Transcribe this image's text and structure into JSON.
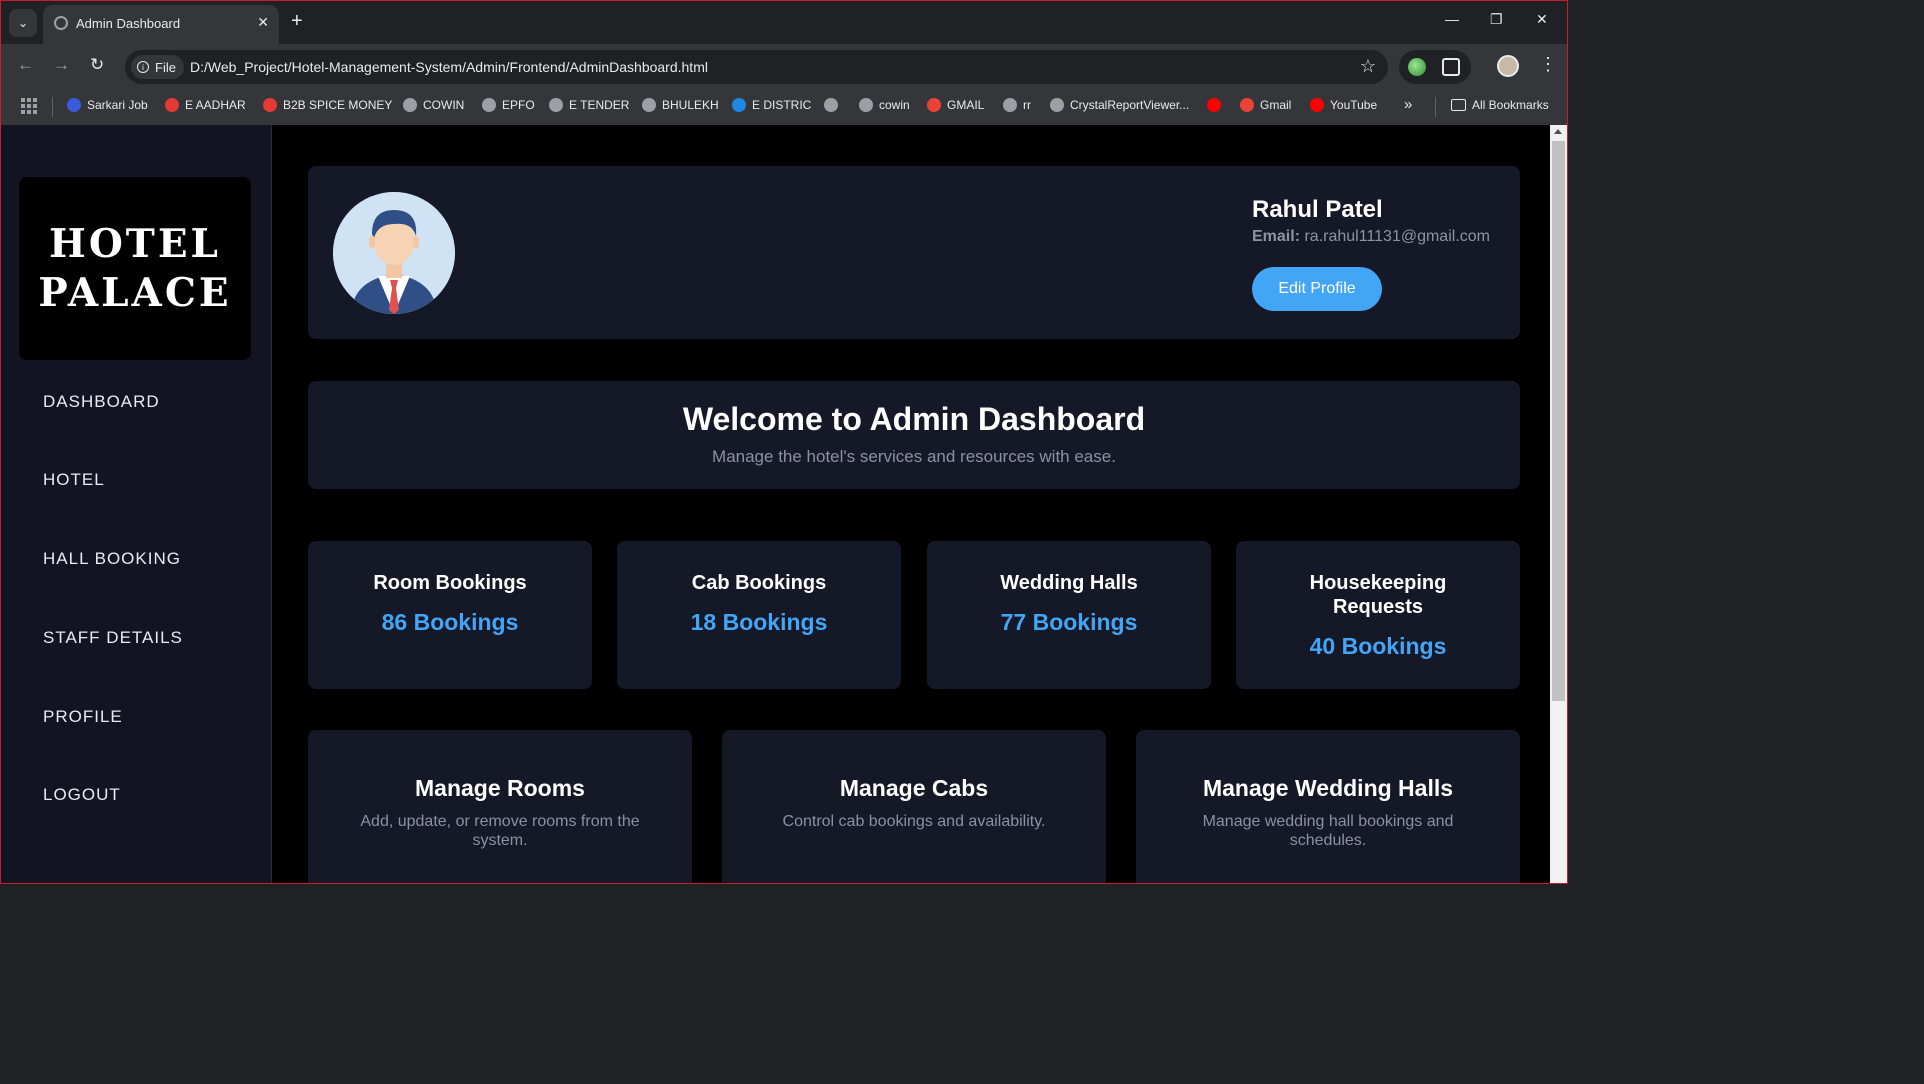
{
  "browser": {
    "tab_title": "Admin Dashboard",
    "file_label": "File",
    "url": "D:/Web_Project/Hotel-Management-System/Admin/Frontend/AdminDashboard.html",
    "bookmarks": [
      {
        "label": "Sarkari Job",
        "color": "#3b5bdb"
      },
      {
        "label": "E AADHAR",
        "color": "#e53935"
      },
      {
        "label": "B2B SPICE MONEY",
        "color": "#e53935"
      },
      {
        "label": "COWIN",
        "color": "#9aa0a6"
      },
      {
        "label": "EPFO",
        "color": "#9aa0a6"
      },
      {
        "label": "E TENDER",
        "color": "#9aa0a6"
      },
      {
        "label": "BHULEKH",
        "color": "#9aa0a6"
      },
      {
        "label": "E DISTRIC",
        "color": "#1e88e5"
      },
      {
        "label": "",
        "color": "#9aa0a6"
      },
      {
        "label": "cowin",
        "color": "#9aa0a6"
      },
      {
        "label": "GMAIL",
        "color": "#ea4335"
      },
      {
        "label": "rr",
        "color": "#9aa0a6"
      },
      {
        "label": "CrystalReportViewer...",
        "color": "#9aa0a6"
      },
      {
        "label": "",
        "color": "#ff0000"
      },
      {
        "label": "Gmail",
        "color": "#ea4335"
      },
      {
        "label": "YouTube",
        "color": "#ff0000"
      }
    ],
    "more_bookmarks": "»",
    "all_bookmarks": "All Bookmarks"
  },
  "sidebar": {
    "logo_line1": "HOTEL",
    "logo_line2": "PALACE",
    "items": [
      "DASHBOARD",
      "HOTEL",
      "HALL BOOKING",
      "STAFF DETAILS",
      "PROFILE",
      "LOGOUT"
    ]
  },
  "profile": {
    "name": "Rahul Patel",
    "email_label": "Email:",
    "email": "ra.rahul11131@gmail.com",
    "edit_button": "Edit Profile"
  },
  "welcome": {
    "title": "Welcome to Admin Dashboard",
    "subtitle": "Manage the hotel's services and resources with ease."
  },
  "stats": [
    {
      "title": "Room Bookings",
      "value": "86 Bookings"
    },
    {
      "title": "Cab Bookings",
      "value": "18 Bookings"
    },
    {
      "title": "Wedding Halls",
      "value": "77 Bookings"
    },
    {
      "title": "Housekeeping Requests",
      "value": "40 Bookings"
    }
  ],
  "manage": [
    {
      "title": "Manage Rooms",
      "desc": "Add, update, or remove rooms from the system."
    },
    {
      "title": "Manage Cabs",
      "desc": "Control cab bookings and availability."
    },
    {
      "title": "Manage Wedding Halls",
      "desc": "Manage wedding hall bookings and schedules."
    }
  ],
  "colors": {
    "accent": "#42a5f5",
    "card_bg": "#151826",
    "sidebar_bg": "#121521"
  }
}
